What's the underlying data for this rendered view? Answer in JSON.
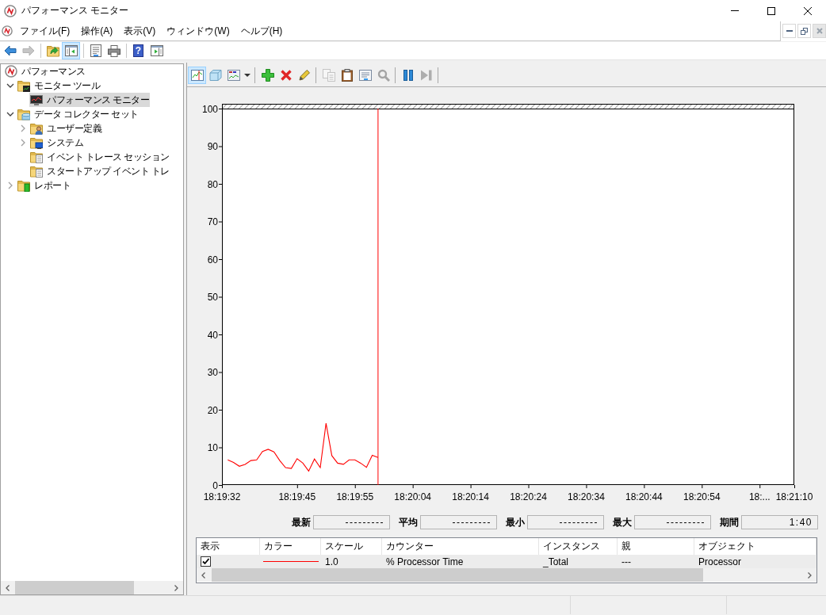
{
  "window": {
    "title": "パフォーマンス モニター"
  },
  "menu_bar": {
    "items": [
      "ファイル(F)",
      "操作(A)",
      "表示(V)",
      "ウィンドウ(W)",
      "ヘルプ(H)"
    ]
  },
  "toolbar": {
    "groups": [
      [
        {
          "kind": "back",
          "selected": false,
          "disabled": false
        },
        {
          "kind": "forward",
          "selected": false,
          "disabled": true
        }
      ],
      [
        {
          "kind": "up",
          "selected": false,
          "disabled": false
        },
        {
          "kind": "tree",
          "selected": true,
          "disabled": false
        }
      ],
      [
        {
          "kind": "export",
          "selected": false,
          "disabled": false
        },
        {
          "kind": "print",
          "selected": false,
          "disabled": false
        }
      ],
      [
        {
          "kind": "help",
          "glyph": "?",
          "selected": false,
          "disabled": false
        },
        {
          "kind": "pane",
          "selected": false,
          "disabled": false
        }
      ]
    ]
  },
  "tree": [
    {
      "kind": "root",
      "label": "パフォーマンス",
      "selected": false,
      "children": [
        {
          "kind": "tools",
          "label": "モニター ツール",
          "expanded": true,
          "selected": false,
          "children": [
            {
              "kind": "monitor",
              "label": "パフォーマンス モニター",
              "selected": true
            }
          ]
        },
        {
          "kind": "collectors",
          "label": "データ コレクター セット",
          "expanded": true,
          "selected": false,
          "children": [
            {
              "kind": "user",
              "label": "ユーザー定義",
              "expanded": false,
              "selected": false
            },
            {
              "kind": "system",
              "label": "システム",
              "expanded": false,
              "selected": false
            },
            {
              "kind": "trace",
              "label": "イベント トレース セッション",
              "selected": false
            },
            {
              "kind": "trace",
              "label": "スタートアップ イベント トレ",
              "selected": false
            }
          ]
        },
        {
          "kind": "reports",
          "label": "レポート",
          "expanded": false,
          "selected": false
        }
      ]
    }
  ],
  "chart_toolbar": {
    "groups": [
      [
        {
          "kind": "graph",
          "selected": true,
          "disabled": false
        },
        {
          "kind": "cube",
          "selected": false,
          "disabled": false
        },
        {
          "kind": "report",
          "selected": false,
          "disabled": false
        },
        {
          "kind": "dropdown",
          "selected": false,
          "disabled": false
        }
      ],
      [
        {
          "kind": "add",
          "selected": false,
          "disabled": false
        },
        {
          "kind": "delete",
          "selected": false,
          "disabled": false
        },
        {
          "kind": "highlight",
          "selected": false,
          "disabled": false
        }
      ],
      [
        {
          "kind": "copy",
          "selected": false,
          "disabled": true
        },
        {
          "kind": "paste",
          "selected": false,
          "disabled": false
        },
        {
          "kind": "properties",
          "selected": false,
          "disabled": false
        },
        {
          "kind": "zoom",
          "selected": false,
          "disabled": true
        }
      ],
      [
        {
          "kind": "pause",
          "selected": false,
          "disabled": false
        },
        {
          "kind": "step",
          "selected": false,
          "disabled": true
        }
      ]
    ]
  },
  "graph": {
    "chart_data": {
      "type": "line",
      "categories": [
        "18:19:32",
        null,
        null,
        null,
        null,
        null,
        null,
        null,
        null,
        null,
        null,
        null,
        null,
        "18:19:45",
        null,
        null,
        null,
        null,
        null,
        null,
        null,
        null,
        null,
        "18:19:55",
        null,
        null,
        null,
        null,
        null,
        null,
        null,
        null,
        null,
        "18:20:04",
        null,
        null,
        null,
        null,
        null,
        null,
        null,
        null,
        null,
        "18:20:14",
        null,
        null,
        null,
        null,
        null,
        null,
        null,
        null,
        null,
        "18:20:24",
        null,
        null,
        null,
        null,
        null,
        null,
        null,
        null,
        null,
        "18:20:34",
        null,
        null,
        null,
        null,
        null,
        null,
        null,
        null,
        null,
        "18:20:44",
        null,
        null,
        null,
        null,
        null,
        null,
        null,
        null,
        null,
        "18:20:54",
        null,
        null,
        null,
        null,
        null,
        null,
        null,
        null,
        null,
        "18:...",
        null,
        null,
        null,
        null,
        null,
        "18:21:10"
      ],
      "series": [
        {
          "color": "#ff0000",
          "values": [
            null,
            6.7,
            6.0,
            5.0,
            5.5,
            6.5,
            6.7,
            8.9,
            9.5,
            8.8,
            6.5,
            4.6,
            4.4,
            7.0,
            5.8,
            3.7,
            6.9,
            4.6,
            16.4,
            7.8,
            5.8,
            5.5,
            6.7,
            6.7,
            5.8,
            4.7,
            7.9,
            7.3,
            null,
            null,
            null,
            null,
            null,
            null,
            null,
            null,
            null,
            null,
            null,
            null,
            null,
            null,
            null,
            null,
            null,
            null,
            null,
            null,
            null,
            null,
            null,
            null,
            null,
            null,
            null,
            null,
            null,
            null,
            null,
            null,
            null,
            null,
            null,
            null,
            null,
            null,
            null,
            null,
            null,
            null,
            null,
            null,
            null,
            null,
            null,
            null,
            null,
            null,
            null,
            null,
            null,
            null,
            null,
            null,
            null,
            null,
            null,
            null,
            null,
            null,
            null,
            null,
            null,
            null,
            null,
            null,
            null,
            null,
            null,
            null
          ]
        }
      ],
      "ylim": [
        0,
        100
      ],
      "yticks": [
        0,
        10,
        20,
        30,
        40,
        50,
        60,
        70,
        80,
        90,
        100
      ]
    }
  },
  "stats": [
    {
      "label": "最新",
      "value": "---------"
    },
    {
      "label": "平均",
      "value": "---------"
    },
    {
      "label": "最小",
      "value": "---------"
    },
    {
      "label": "最大",
      "value": "---------"
    },
    {
      "label": "期間",
      "value": "1:40"
    }
  ],
  "counter_table": {
    "columns": [
      "表示",
      "カラー",
      "スケール",
      "カウンター",
      "インスタンス",
      "親",
      "オブジェクト"
    ],
    "rows": [
      {
        "shown": true,
        "color": "#ff0000",
        "scale": "1.0",
        "counter": "% Processor Time",
        "instance": "_Total",
        "parent": "---",
        "object": "Processor",
        "selected": true
      }
    ]
  }
}
